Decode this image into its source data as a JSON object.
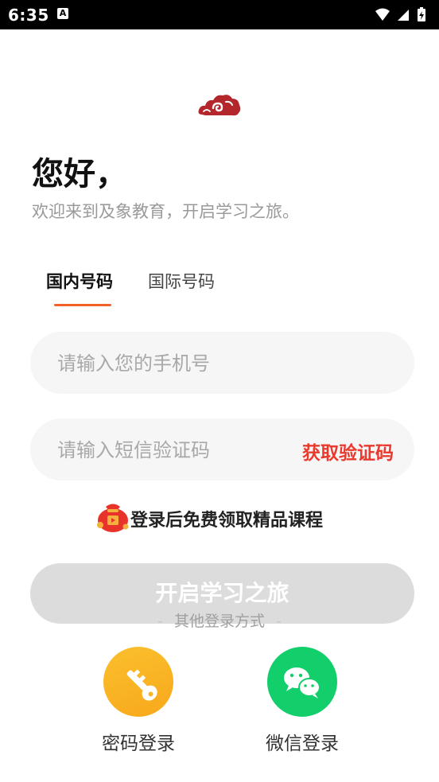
{
  "status_bar": {
    "time": "6:35",
    "notification_letter": "A"
  },
  "greeting": "您好，",
  "subtitle": "欢迎来到及象教育，开启学习之旅。",
  "tabs": [
    {
      "label": "国内号码",
      "active": true
    },
    {
      "label": "国际号码",
      "active": false
    }
  ],
  "phone_input": {
    "placeholder": "请输入您的手机号",
    "value": ""
  },
  "code_input": {
    "placeholder": "请输入短信验证码",
    "value": ""
  },
  "get_code_label": "获取验证码",
  "promo_text": "登录后免费领取精品课程",
  "main_button_label": "开启学习之旅",
  "other_methods_label": "其他登录方式",
  "alt_logins": [
    {
      "label": "密码登录",
      "icon": "key-icon"
    },
    {
      "label": "微信登录",
      "icon": "wechat-icon"
    }
  ],
  "colors": {
    "accent": "#f0622a",
    "get_code": "#ea3a2e",
    "logo": "#b3262b",
    "password_icon_bg": "#f9b624",
    "wechat_icon_bg": "#13cf6b",
    "button_disabled": "#dcdcdc"
  }
}
